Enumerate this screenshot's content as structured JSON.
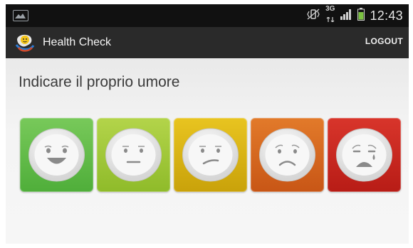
{
  "status_bar": {
    "network": "3G",
    "time": "12:43"
  },
  "action_bar": {
    "title": "Health Check",
    "logout_label": "LOGOUT"
  },
  "main": {
    "prompt": "Indicare il proprio umore"
  },
  "moods": [
    {
      "name": "very-happy",
      "color": "#6cbf4a"
    },
    {
      "name": "happy",
      "color": "#a6cc3c"
    },
    {
      "name": "neutral",
      "color": "#d9b60f"
    },
    {
      "name": "sad",
      "color": "#d8661c"
    },
    {
      "name": "very-sad",
      "color": "#cc2a22"
    }
  ],
  "colors": {
    "status_bar": "#111111",
    "action_bar": "#2a2a2a",
    "background": "#f2f2f2"
  }
}
